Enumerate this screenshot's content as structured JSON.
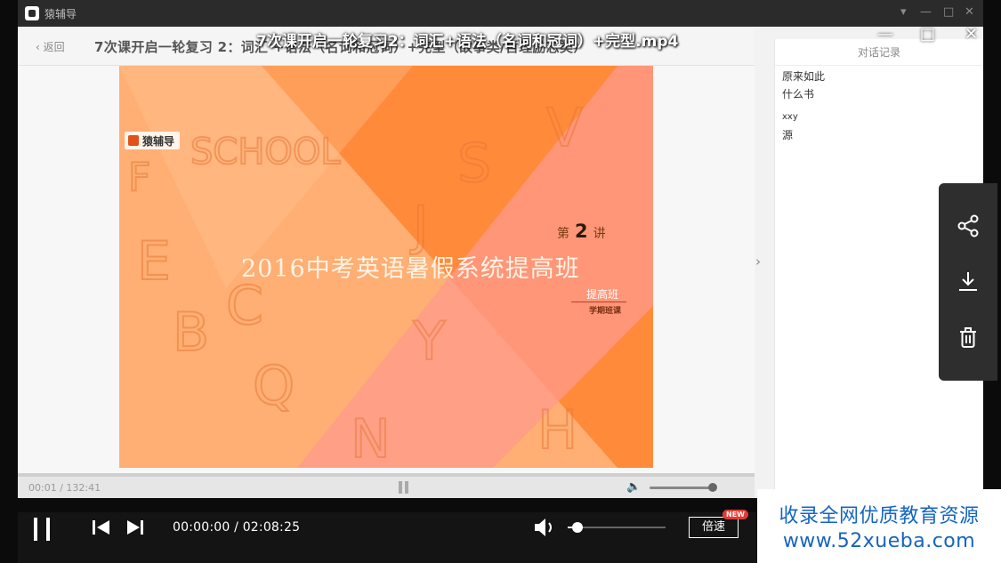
{
  "inner_window": {
    "app_name": "猿辅导",
    "window_controls": [
      "▾",
      "—",
      "□",
      "✕"
    ],
    "back_label": "‹ 返回",
    "course_title": "7次课开启一轮复习 2：词汇 +语法（名词和冠词）+完型（故事类/哲理励志类）"
  },
  "slide": {
    "brand": "猿辅导",
    "lecture_prefix": "第",
    "lecture_number": "2",
    "lecture_suffix": "讲",
    "title": "2016中考英语暑假系统提高班",
    "subtitle": "提高班",
    "subtitle2": "学期班课",
    "colors": {
      "base": "#ff8a3a",
      "light": "#ffb27a",
      "pink": "#ff9a8c"
    }
  },
  "chat": {
    "title": "对话记录",
    "messages": [
      "原来如此",
      "什么书",
      "xxy",
      "源"
    ]
  },
  "inner_player": {
    "time": "00:01 / 132:41",
    "volume_fraction": 0.9
  },
  "outer_player": {
    "file_title": "7次课开启一轮复习2：词汇+语法（名词和冠词）+完型.mp4",
    "window_controls": [
      "—",
      "□",
      "✕"
    ],
    "time_display": "00:00:00 / 02:08:25",
    "speed_label": "倍速",
    "new_badge": "NEW",
    "volume_fraction": 0.1
  },
  "side_tools": [
    "share-icon",
    "download-icon",
    "delete-icon"
  ],
  "watermark": {
    "line1": "收录全网优质教育资源",
    "line2": "www.52xueba.com"
  }
}
